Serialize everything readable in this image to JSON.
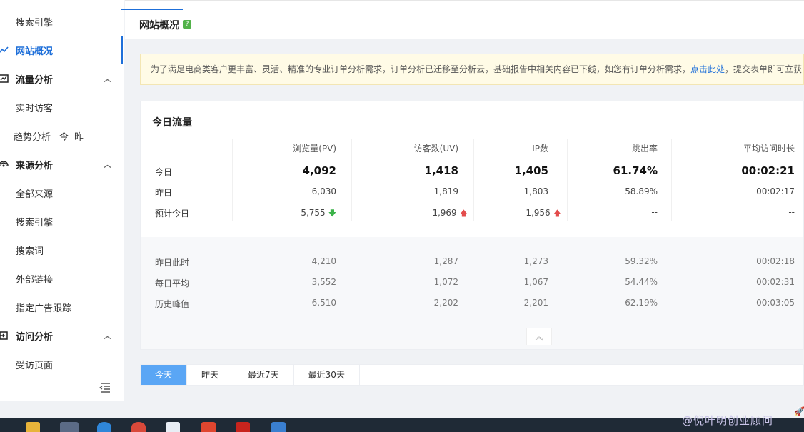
{
  "sidebar": {
    "items": [
      {
        "label": "搜索引擎",
        "kind": "sub"
      },
      {
        "label": "网站概况",
        "kind": "active",
        "icon": "line-chart-icon"
      },
      {
        "label": "流量分析",
        "kind": "head",
        "icon": "trend-chart-icon"
      },
      {
        "label": "实时访客",
        "kind": "sub"
      },
      {
        "label": "趋势分析",
        "kind": "sub",
        "tags": [
          "今",
          "昨"
        ]
      },
      {
        "label": "来源分析",
        "kind": "head",
        "icon": "signal-icon"
      },
      {
        "label": "全部来源",
        "kind": "sub"
      },
      {
        "label": "搜索引擎",
        "kind": "sub"
      },
      {
        "label": "搜索词",
        "kind": "sub"
      },
      {
        "label": "外部链接",
        "kind": "sub"
      },
      {
        "label": "指定广告跟踪",
        "kind": "sub"
      },
      {
        "label": "访问分析",
        "kind": "head",
        "icon": "login-icon"
      },
      {
        "label": "受访页面",
        "kind": "sub"
      }
    ]
  },
  "header": {
    "title": "网站概况",
    "help": "?"
  },
  "notice": {
    "text": "为了满足电商类客户更丰富、灵活、精准的专业订单分析需求，订单分析已迁移至分析云，基础报告中相关内容已下线，如您有订单分析需求，",
    "link": "点击此处",
    "tail": "，提交表单即可立获"
  },
  "card": {
    "title": "今日流量",
    "columns": [
      "浏览量(PV)",
      "访客数(UV)",
      "IP数",
      "跳出率",
      "平均访问时长"
    ],
    "rows_top": [
      {
        "label": "今日",
        "values": [
          "4,092",
          "1,418",
          "1,405",
          "61.74%",
          "00:02:21"
        ]
      },
      {
        "label": "昨日",
        "values": [
          "6,030",
          "1,819",
          "1,803",
          "58.89%",
          "00:02:17"
        ]
      },
      {
        "label": "预计今日",
        "values": [
          "5,755",
          "1,969",
          "1,956",
          "--",
          "--"
        ],
        "arrows": [
          "down-green",
          "up-red",
          "up-red",
          "",
          ""
        ]
      }
    ],
    "rows_bottom": [
      {
        "label": "昨日此时",
        "values": [
          "4,210",
          "1,287",
          "1,273",
          "59.32%",
          "00:02:18"
        ]
      },
      {
        "label": "每日平均",
        "values": [
          "3,552",
          "1,072",
          "1,067",
          "54.44%",
          "00:02:31"
        ]
      },
      {
        "label": "历史峰值",
        "values": [
          "6,510",
          "2,202",
          "2,201",
          "62.19%",
          "00:03:05"
        ]
      }
    ]
  },
  "tabs": [
    "今天",
    "昨天",
    "最近7天",
    "最近30天"
  ],
  "watermark": "@倪叶明创业顾问",
  "colors": {
    "accent": "#1e6fd9",
    "tab_active": "#5aa6f5",
    "up": "#e34c4c",
    "down": "#3cb34a"
  }
}
